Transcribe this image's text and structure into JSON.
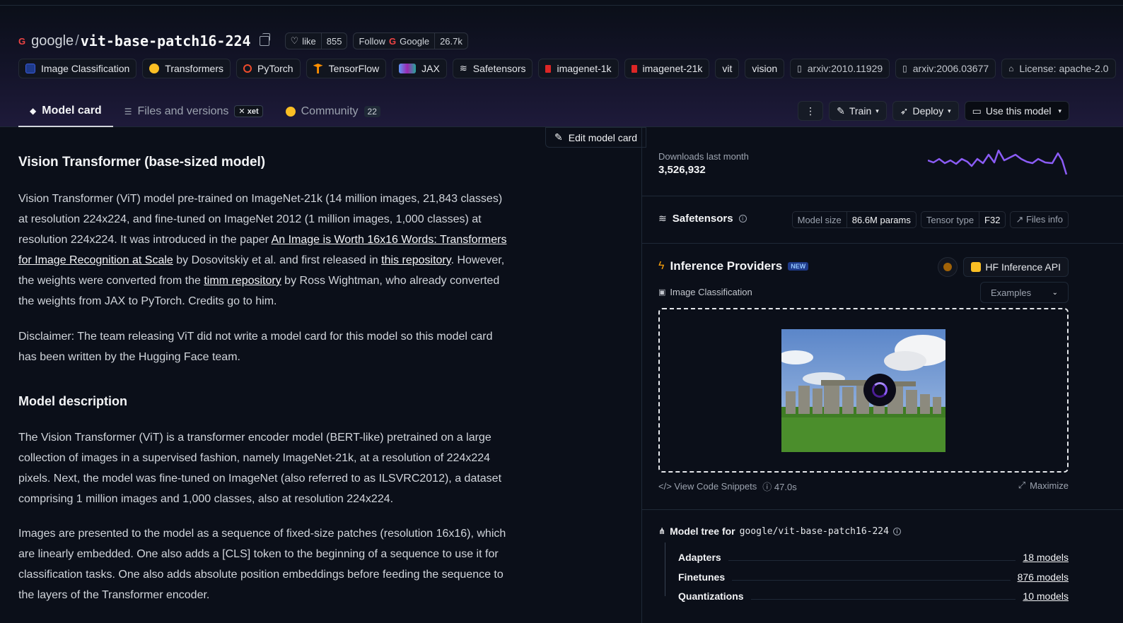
{
  "header": {
    "org": "google",
    "repo": "vit-base-patch16-224",
    "like_label": "like",
    "like_count": "855",
    "follow_label": "Follow",
    "follow_org": "Google",
    "follow_count": "26.7k"
  },
  "tags": [
    {
      "label": "Image Classification",
      "icon": "image-classification-icon",
      "color": "#3b5bdb"
    },
    {
      "label": "Transformers",
      "icon": "hugging-face-icon",
      "color": "#fbbf24"
    },
    {
      "label": "PyTorch",
      "icon": "pytorch-icon",
      "color": "#ee4c2c"
    },
    {
      "label": "TensorFlow",
      "icon": "tensorflow-icon",
      "color": "#ff8f00"
    },
    {
      "label": "JAX",
      "icon": "jax-icon",
      "color": "#6d5dfc"
    },
    {
      "label": "Safetensors",
      "icon": "safetensors-icon",
      "color": "#e5e7eb"
    },
    {
      "label": "imagenet-1k",
      "icon": "dataset-icon",
      "color": "#dc2626"
    },
    {
      "label": "imagenet-21k",
      "icon": "dataset-icon",
      "color": "#dc2626"
    },
    {
      "label": "vit",
      "icon": "",
      "color": ""
    },
    {
      "label": "vision",
      "icon": "",
      "color": ""
    },
    {
      "label": "arxiv:2010.11929",
      "icon": "paper-icon",
      "color": "#9ca3af"
    },
    {
      "label": "arxiv:2006.03677",
      "icon": "paper-icon",
      "color": "#9ca3af"
    },
    {
      "label": "License: apache-2.0",
      "icon": "license-icon",
      "color": "#9ca3af"
    }
  ],
  "tabs": {
    "model_card": "Model card",
    "files": "Files and versions",
    "xet": "xet",
    "community": "Community",
    "community_count": "22"
  },
  "actions": {
    "more": "⋮",
    "train": "Train",
    "deploy": "Deploy",
    "use": "Use this model"
  },
  "card": {
    "edit": "Edit model card",
    "title": "Vision Transformer (base-sized model)",
    "p1_a": "Vision Transformer (ViT) model pre-trained on ImageNet-21k (14 million images, 21,843 classes) at resolution 224x224, and fine-tuned on ImageNet 2012 (1 million images, 1,000 classes) at resolution 224x224. It was introduced in the paper ",
    "p1_link1": "An Image is Worth 16x16 Words: Transformers for Image Recognition at Scale",
    "p1_b": " by Dosovitskiy et al. and first released in ",
    "p1_link2": "this repository",
    "p1_c": ". However, the weights were converted from the ",
    "p1_link3": "timm repository",
    "p1_d": " by Ross Wightman, who already converted the weights from JAX to PyTorch. Credits go to him.",
    "p2": "Disclaimer: The team releasing ViT did not write a model card for this model so this model card has been written by the Hugging Face team.",
    "h2": "Model description",
    "p3": "The Vision Transformer (ViT) is a transformer encoder model (BERT-like) pretrained on a large collection of images in a supervised fashion, namely ImageNet-21k, at a resolution of 224x224 pixels. Next, the model was fine-tuned on ImageNet (also referred to as ILSVRC2012), a dataset comprising 1 million images and 1,000 classes, also at resolution 224x224.",
    "p4": "Images are presented to the model as a sequence of fixed-size patches (resolution 16x16), which are linearly embedded. One also adds a [CLS] token to the beginning of a sequence to use it for classification tasks. One also adds absolute position embeddings before feeding the sequence to the layers of the Transformer encoder."
  },
  "side": {
    "downloads_label": "Downloads last month",
    "downloads_count": "3,526,932",
    "safetensors": "Safetensors",
    "model_size_k": "Model size",
    "model_size_v": "86.6M params",
    "tensor_type_k": "Tensor type",
    "tensor_type_v": "F32",
    "files_info": "Files info",
    "inference_title": "Inference Providers",
    "new_badge": "NEW",
    "provider": "HF Inference API",
    "task": "Image Classification",
    "examples": "Examples",
    "view_snippets": "View Code Snippets",
    "time": "47.0s",
    "maximize": "Maximize",
    "tree_title": "Model tree for",
    "tree_repo": "google/vit-base-patch16-224",
    "tree": [
      {
        "name": "Adapters",
        "value": "18 models"
      },
      {
        "name": "Finetunes",
        "value": "876 models"
      },
      {
        "name": "Quantizations",
        "value": "10 models"
      }
    ]
  },
  "colors": {
    "accent": "#8b5cf6",
    "background": "#0b0f19",
    "sparkline": "#8b5cf6"
  }
}
